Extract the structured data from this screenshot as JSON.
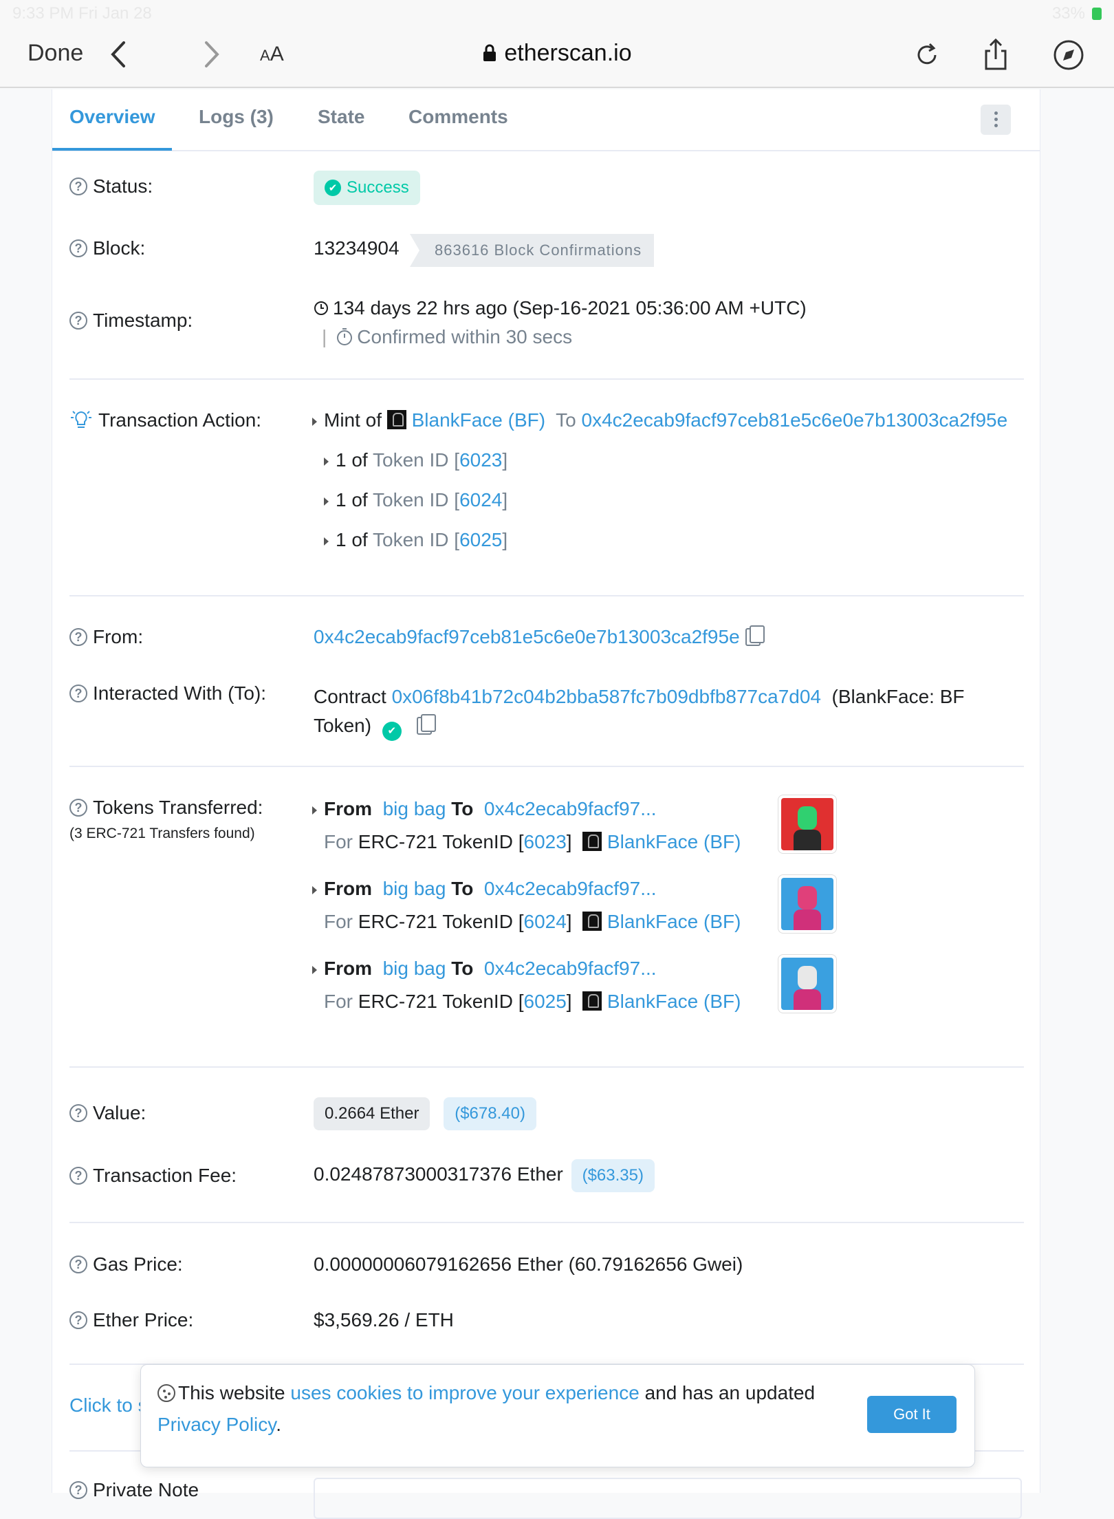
{
  "statusbar": {
    "time": "9:33 PM  Fri Jan 28",
    "battery": "33%"
  },
  "browser": {
    "done": "Done",
    "aa_small": "A",
    "aa_big": "A",
    "url": "etherscan.io"
  },
  "tabs": [
    {
      "label": "Overview"
    },
    {
      "label": "Logs (3)"
    },
    {
      "label": "State"
    },
    {
      "label": "Comments"
    }
  ],
  "status": {
    "label": "Status:",
    "value": "Success"
  },
  "block": {
    "label": "Block:",
    "number": "13234904",
    "confirmations": "863616 Block Confirmations"
  },
  "timestamp": {
    "label": "Timestamp:",
    "value": "134 days 22 hrs ago (Sep-16-2021 05:36:00 AM +UTC)",
    "sep": "|",
    "confirmed": "Confirmed within 30 secs"
  },
  "action": {
    "label": "Transaction Action:",
    "mint_of": "Mint of",
    "token": "BlankFace (BF)",
    "to_label": "To",
    "to": "0x4c2ecab9facf97ceb81e5c6e0e7b13003ca2f95e",
    "items": [
      {
        "count": "1",
        "of": "of",
        "tid_label": "Token ID",
        "id": "6023"
      },
      {
        "count": "1",
        "of": "of",
        "tid_label": "Token ID",
        "id": "6024"
      },
      {
        "count": "1",
        "of": "of",
        "tid_label": "Token ID",
        "id": "6025"
      }
    ]
  },
  "from": {
    "label": "From:",
    "address": "0x4c2ecab9facf97ceb81e5c6e0e7b13003ca2f95e"
  },
  "interacted": {
    "label": "Interacted With (To):",
    "prefix": "Contract",
    "address": "0x06f8b41b72c04b2bba587fc7b09dbfb877ca7d04",
    "name": "(BlankFace: BF",
    "name2": "Token)"
  },
  "tokens": {
    "label": "Tokens Transferred:",
    "sub": "(3 ERC-721 Transfers found)",
    "transfers": [
      {
        "from_label": "From",
        "from": "big bag",
        "to_label": "To",
        "to": "0x4c2ecab9facf97...",
        "for": "For",
        "std": "ERC-721 TokenID",
        "id": "6023",
        "token": "BlankFace (BF)",
        "bg": "#e03030",
        "head": "#30d070"
      },
      {
        "from_label": "From",
        "from": "big bag",
        "to_label": "To",
        "to": "0x4c2ecab9facf97...",
        "for": "For",
        "std": "ERC-721 TokenID",
        "id": "6024",
        "token": "BlankFace (BF)",
        "bg": "#3aa0e0",
        "head": "#e0407a"
      },
      {
        "from_label": "From",
        "from": "big bag",
        "to_label": "To",
        "to": "0x4c2ecab9facf97...",
        "for": "For",
        "std": "ERC-721 TokenID",
        "id": "6025",
        "token": "BlankFace (BF)",
        "bg": "#3aa0e0",
        "head": "#e8e8e8"
      }
    ]
  },
  "value": {
    "label": "Value:",
    "ether": "0.2664 Ether",
    "usd": "($678.40)"
  },
  "fee": {
    "label": "Transaction Fee:",
    "ether": "0.02487873000317376 Ether",
    "usd": "($63.35)"
  },
  "gas": {
    "label": "Gas Price:",
    "value": "0.00000006079162656 Ether (60.79162656 Gwei)"
  },
  "ether_price": {
    "label": "Ether Price:",
    "value": "$3,569.26 / ETH"
  },
  "click_more": "Click to s",
  "private_note": "Private Note",
  "cookie": {
    "pre": "This website",
    "link": "uses cookies to improve your experience",
    "mid": "and has an updated",
    "policy": "Privacy Policy",
    "end": ".",
    "button": "Got It"
  },
  "colors": {
    "accent": "#3498db",
    "success": "#00c9a7",
    "muted": "#77838f"
  }
}
